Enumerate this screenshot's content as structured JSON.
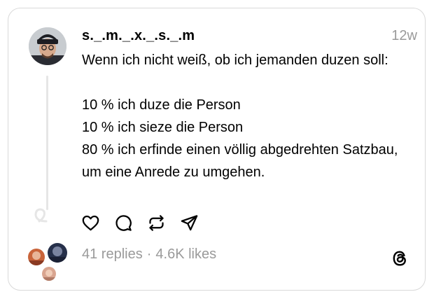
{
  "post": {
    "username": "s._.m._.x._.s._.m",
    "time": "12w",
    "text": "Wenn ich nicht weiß, ob ich jemanden duzen soll:\n\n10 % ich duze die Person\n10 % ich sieze die Person\n80 % ich erfinde einen völlig abgedrehten Satzbau, um eine Anrede zu umgehen."
  },
  "stats": {
    "replies": "41 replies",
    "separator": "·",
    "likes": "4.6K likes"
  },
  "actions": [
    "heart-icon",
    "comment-icon",
    "repost-icon",
    "share-icon"
  ],
  "icons": {
    "brand": "threads-logo-icon"
  },
  "colors": {
    "muted": "#9a9a9a",
    "border": "#d9d9d9",
    "line": "#e6e6e6"
  }
}
